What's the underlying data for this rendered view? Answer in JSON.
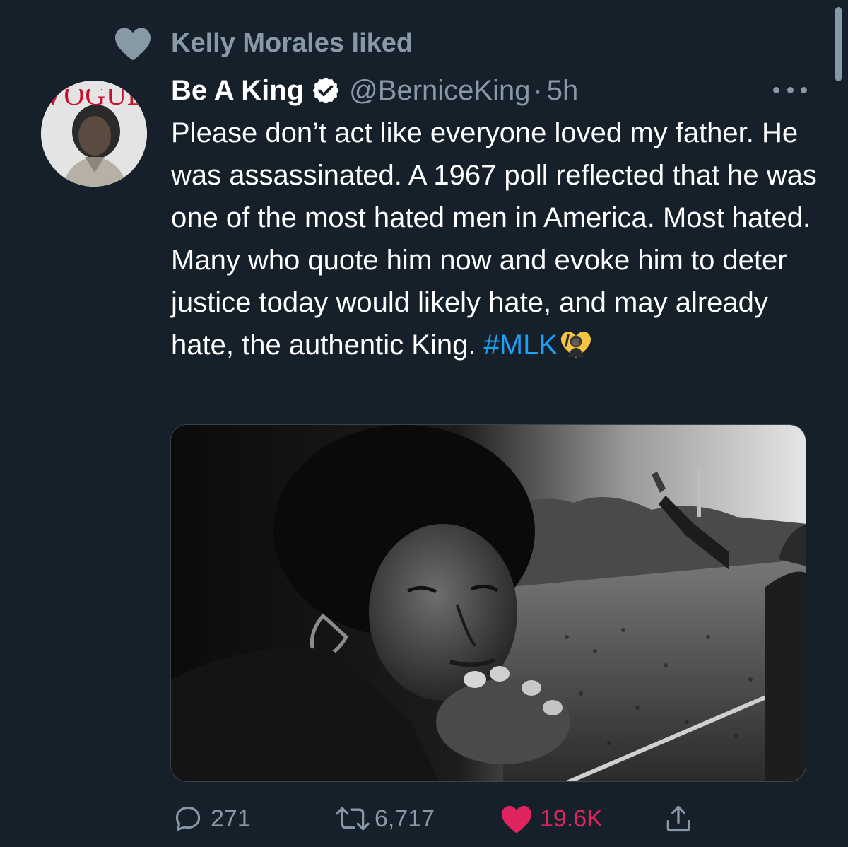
{
  "social_context": {
    "icon": "heart-icon",
    "text": "Kelly Morales liked"
  },
  "tweet": {
    "display_name": "Be A King",
    "verified": true,
    "handle": "@BerniceKing",
    "separator": "·",
    "time": "5h",
    "text": "Please don’t act like everyone loved my father. He was assassinated. A 1967 poll reflected that he was one of the most hated men in America. Most hated. Many who quote him now and evoke him to deter justice today would likely hate, and may already hate, the authentic King. ",
    "hashtag": "#MLK",
    "emoji": "dreamer-emoji-icon",
    "avatar_logo_text": "VOGUE"
  },
  "actions": {
    "reply_count": "271",
    "retweet_count": "6,717",
    "like_count": "19.6K",
    "liked": true
  },
  "colors": {
    "background": "#15202b",
    "secondary_text": "#8899a6",
    "link": "#1da1f2",
    "like": "#e0245e",
    "primary_text": "#ffffff"
  }
}
